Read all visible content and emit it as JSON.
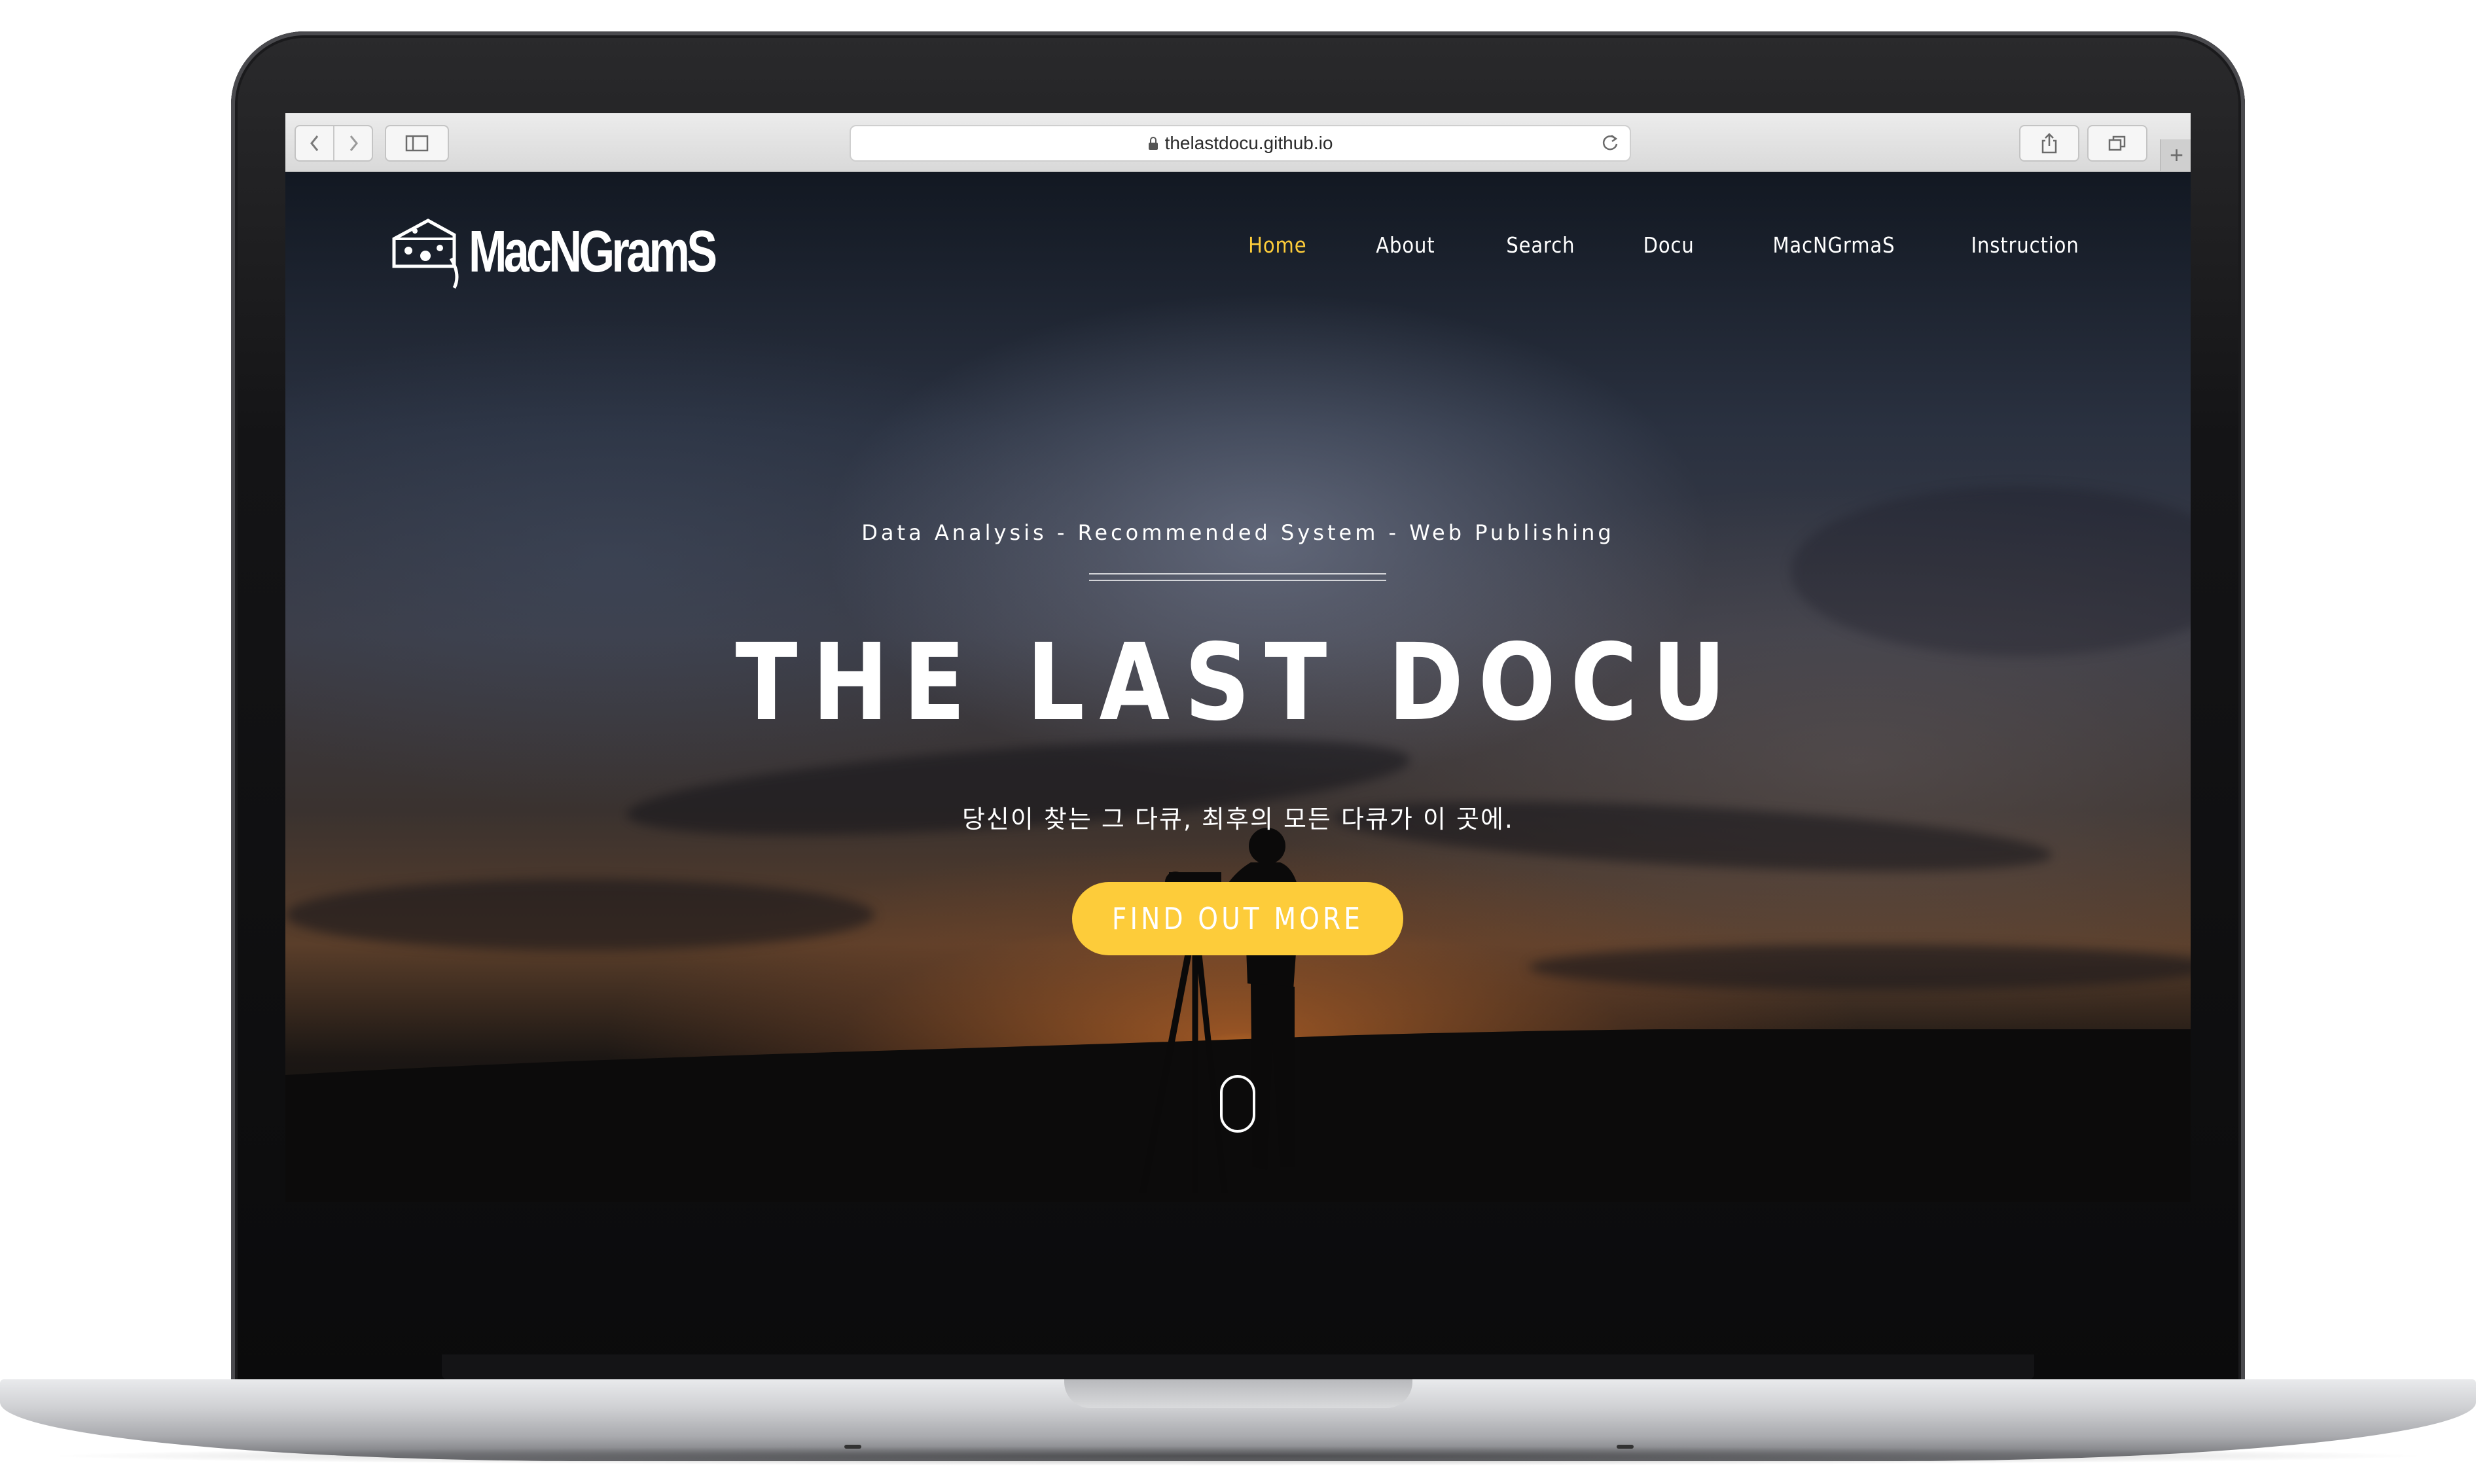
{
  "browser": {
    "url": "thelastdocu.github.io",
    "icons": {
      "back": "chevron-left-icon",
      "forward": "chevron-right-icon",
      "sidebar": "sidebar-icon",
      "lock": "lock-icon",
      "reload": "reload-icon",
      "share": "share-icon",
      "tabs": "tabs-icon",
      "new_tab": "plus-icon"
    },
    "new_tab_label": "+"
  },
  "site": {
    "logo_text": "MacNGramS",
    "logo_icon": "cheese-icon",
    "nav": [
      {
        "label": "Home",
        "active": true
      },
      {
        "label": "About",
        "active": false
      },
      {
        "label": "Search",
        "active": false
      },
      {
        "label": "Docu",
        "active": false
      },
      {
        "label": "MacNGrmaS",
        "active": false
      },
      {
        "label": "Instruction",
        "active": false
      }
    ]
  },
  "hero": {
    "subtitle": "Data Analysis - Recommended System - Web Publishing",
    "title": "THE LAST DOCU",
    "description": "당신이 찾는 그 다큐, 최후의 모든 다큐가 이 곳에.",
    "button_label": "FIND OUT MORE",
    "scroll_icon": "mouse-scroll-icon"
  },
  "colors": {
    "accent": "#fdcc3a",
    "text": "#ffffff"
  }
}
